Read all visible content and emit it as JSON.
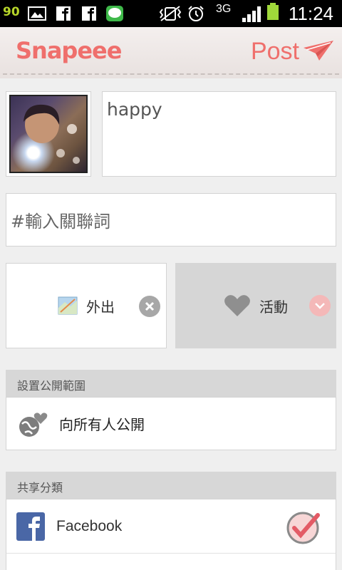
{
  "status_bar": {
    "battery_level_text": "90",
    "network_type": "3G",
    "time": "11:24",
    "icons": [
      "image-icon",
      "facebook-icon",
      "facebook-icon",
      "line-icon",
      "vibrate-icon",
      "alarm-icon",
      "signal-icon",
      "battery-icon"
    ]
  },
  "header": {
    "logo": "Snapeee",
    "post_label": "Post",
    "post_icon": "paper-plane-icon",
    "accent_color": "#ef6f6c"
  },
  "compose": {
    "caption": "happy",
    "keyword_placeholder": "#輸入關聯詞",
    "location_label": "外出",
    "activity_label": "活動"
  },
  "privacy": {
    "section_title": "設置公開範圍",
    "value": "向所有人公開"
  },
  "share": {
    "section_title": "共享分類",
    "items": [
      {
        "label": "Facebook",
        "checked": true
      }
    ]
  }
}
